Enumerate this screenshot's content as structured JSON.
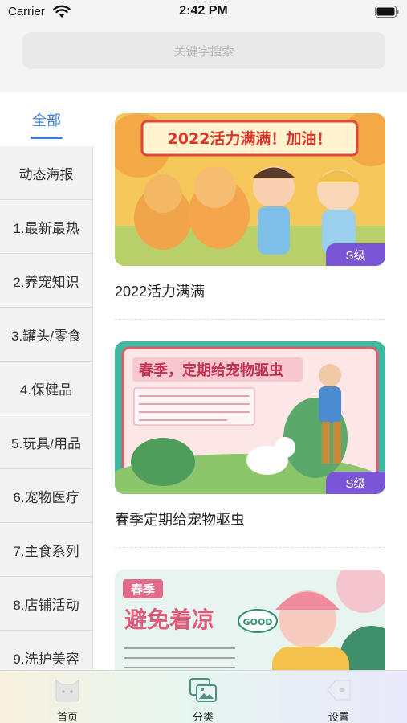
{
  "status_bar": {
    "carrier": "Carrier",
    "time": "2:42 PM"
  },
  "search": {
    "placeholder": "关键字搜索"
  },
  "sidebar": {
    "all_label": "全部",
    "items": [
      {
        "label": "动态海报"
      },
      {
        "label": "1.最新最热"
      },
      {
        "label": "2.养宠知识"
      },
      {
        "label": "3.罐头/零食"
      },
      {
        "label": "4.保健品"
      },
      {
        "label": "5.玩具/用品"
      },
      {
        "label": "6.宠物医疗"
      },
      {
        "label": "7.主食系列"
      },
      {
        "label": "8.店铺活动"
      },
      {
        "label": "9.洗护美容"
      }
    ]
  },
  "cards": [
    {
      "title": "2022活力满满",
      "badge": "S级",
      "banner_text": "2022活力满满！加油！"
    },
    {
      "title": "春季定期给宠物驱虫",
      "badge": "S级",
      "banner_text": "春季，定期给宠物驱虫"
    },
    {
      "title": "",
      "badge": "",
      "banner_text": "避免着凉",
      "tag_text": "春季",
      "bubble_text": "GOOD"
    }
  ],
  "tabbar": {
    "items": [
      {
        "label": "首页",
        "icon": "cat-face-icon"
      },
      {
        "label": "分类",
        "icon": "gallery-icon"
      },
      {
        "label": "设置",
        "icon": "settings-icon"
      }
    ]
  },
  "colors": {
    "accent": "#3a7ee8",
    "badge": "#7a55d6"
  }
}
